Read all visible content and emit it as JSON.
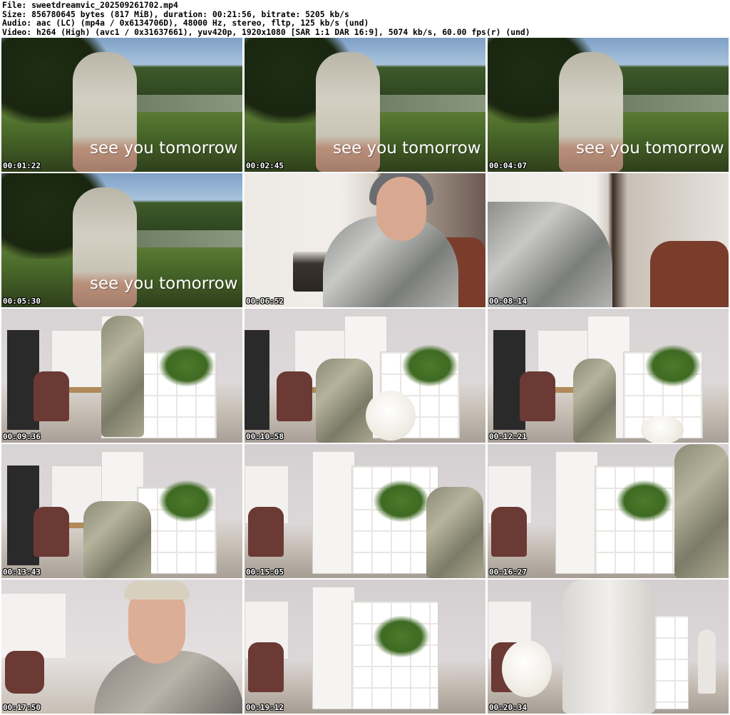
{
  "header": {
    "file_line": "File: sweetdreamvic_202509261702.mp4",
    "size_line": "Size: 856780645 bytes (817 MiB), duration: 00:21:56, bitrate: 5205 kb/s",
    "audio_line": "Audio: aac (LC) (mp4a / 0x6134706D), 48000 Hz, stereo, fltp, 125 kb/s (und)",
    "video_line": "Video: h264 (High) (avc1 / 0x31637661), yuv420p, 1920x1080 [SAR 1:1 DAR 16:9], 5074 kb/s, 60.00 fps(r) (und)"
  },
  "thumbnails": [
    {
      "timestamp": "00:01:22",
      "caption": "see you tomorrow"
    },
    {
      "timestamp": "00:02:45",
      "caption": "see you tomorrow"
    },
    {
      "timestamp": "00:04:07",
      "caption": "see you tomorrow"
    },
    {
      "timestamp": "00:05:30",
      "caption": "see you tomorrow"
    },
    {
      "timestamp": "00:06:52"
    },
    {
      "timestamp": "00:08:14"
    },
    {
      "timestamp": "00:09:36"
    },
    {
      "timestamp": "00:10:58"
    },
    {
      "timestamp": "00:12:21"
    },
    {
      "timestamp": "00:13:43"
    },
    {
      "timestamp": "00:15:05"
    },
    {
      "timestamp": "00:16:27"
    },
    {
      "timestamp": "00:17:50"
    },
    {
      "timestamp": "00:19:12"
    },
    {
      "timestamp": "00:20:34"
    }
  ]
}
